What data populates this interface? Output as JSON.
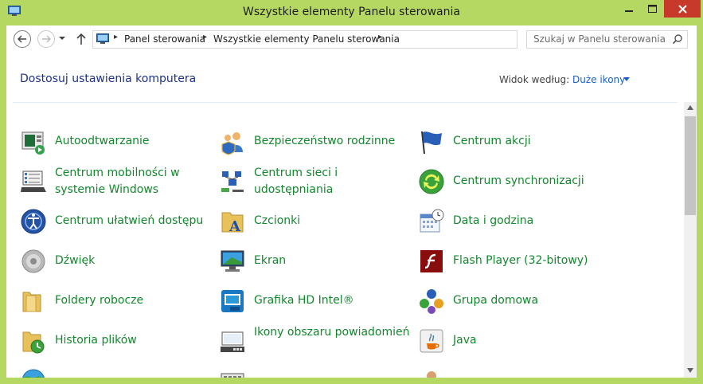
{
  "window": {
    "title": "Wszystkie elementy Panelu sterowania"
  },
  "address": {
    "crumbs": [
      "Panel sterowania",
      "Wszystkie elementy Panelu sterowania"
    ],
    "search_placeholder": "Szukaj w Panelu sterowania"
  },
  "content": {
    "heading": "Dostosuj ustawienia komputera",
    "view_by_label": "Widok według:",
    "view_by_value": "Duże ikony"
  },
  "items": [
    {
      "label": "Autoodtwarzanie",
      "icon": "autoplay-icon"
    },
    {
      "label": "Bezpieczeństwo rodzinne",
      "icon": "family-safety-icon"
    },
    {
      "label": "Centrum akcji",
      "icon": "action-center-flag-icon"
    },
    {
      "label": "Centrum mobilności w systemie Windows",
      "icon": "mobility-center-icon"
    },
    {
      "label": "Centrum sieci i udostępniania",
      "icon": "network-sharing-icon"
    },
    {
      "label": "Centrum synchronizacji",
      "icon": "sync-center-icon"
    },
    {
      "label": "Centrum ułatwień dostępu",
      "icon": "ease-of-access-icon"
    },
    {
      "label": "Czcionki",
      "icon": "fonts-folder-icon"
    },
    {
      "label": "Data i godzina",
      "icon": "date-time-icon"
    },
    {
      "label": "Dźwięk",
      "icon": "speaker-icon"
    },
    {
      "label": "Ekran",
      "icon": "display-icon"
    },
    {
      "label": "Flash Player (32-bitowy)",
      "icon": "flash-player-icon"
    },
    {
      "label": "Foldery robocze",
      "icon": "work-folders-icon"
    },
    {
      "label": "Grafika HD Intel®",
      "icon": "intel-graphics-icon"
    },
    {
      "label": "Grupa domowa",
      "icon": "homegroup-icon"
    },
    {
      "label": "Historia plików",
      "icon": "file-history-icon"
    },
    {
      "label": "Ikony obszaru powiadomień",
      "icon": "notification-area-icon"
    },
    {
      "label": "Java",
      "icon": "java-icon"
    }
  ],
  "colors": {
    "accent": "#b5d862",
    "link": "#14862e",
    "heading": "#1e3287",
    "close": "#c7392b"
  }
}
